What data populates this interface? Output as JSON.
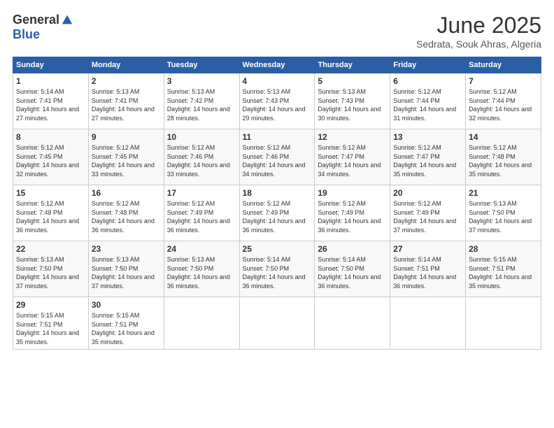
{
  "logo": {
    "general": "General",
    "blue": "Blue"
  },
  "title": "June 2025",
  "subtitle": "Sedrata, Souk Ahras, Algeria",
  "days_header": [
    "Sunday",
    "Monday",
    "Tuesday",
    "Wednesday",
    "Thursday",
    "Friday",
    "Saturday"
  ],
  "weeks": [
    [
      {
        "day": "1",
        "sunrise": "5:14 AM",
        "sunset": "7:41 PM",
        "daylight": "14 hours and 27 minutes."
      },
      {
        "day": "2",
        "sunrise": "5:13 AM",
        "sunset": "7:41 PM",
        "daylight": "14 hours and 27 minutes."
      },
      {
        "day": "3",
        "sunrise": "5:13 AM",
        "sunset": "7:42 PM",
        "daylight": "14 hours and 28 minutes."
      },
      {
        "day": "4",
        "sunrise": "5:13 AM",
        "sunset": "7:43 PM",
        "daylight": "14 hours and 29 minutes."
      },
      {
        "day": "5",
        "sunrise": "5:13 AM",
        "sunset": "7:43 PM",
        "daylight": "14 hours and 30 minutes."
      },
      {
        "day": "6",
        "sunrise": "5:12 AM",
        "sunset": "7:44 PM",
        "daylight": "14 hours and 31 minutes."
      },
      {
        "day": "7",
        "sunrise": "5:12 AM",
        "sunset": "7:44 PM",
        "daylight": "14 hours and 32 minutes."
      }
    ],
    [
      {
        "day": "8",
        "sunrise": "5:12 AM",
        "sunset": "7:45 PM",
        "daylight": "14 hours and 32 minutes."
      },
      {
        "day": "9",
        "sunrise": "5:12 AM",
        "sunset": "7:45 PM",
        "daylight": "14 hours and 33 minutes."
      },
      {
        "day": "10",
        "sunrise": "5:12 AM",
        "sunset": "7:46 PM",
        "daylight": "14 hours and 33 minutes."
      },
      {
        "day": "11",
        "sunrise": "5:12 AM",
        "sunset": "7:46 PM",
        "daylight": "14 hours and 34 minutes."
      },
      {
        "day": "12",
        "sunrise": "5:12 AM",
        "sunset": "7:47 PM",
        "daylight": "14 hours and 34 minutes."
      },
      {
        "day": "13",
        "sunrise": "5:12 AM",
        "sunset": "7:47 PM",
        "daylight": "14 hours and 35 minutes."
      },
      {
        "day": "14",
        "sunrise": "5:12 AM",
        "sunset": "7:48 PM",
        "daylight": "14 hours and 35 minutes."
      }
    ],
    [
      {
        "day": "15",
        "sunrise": "5:12 AM",
        "sunset": "7:48 PM",
        "daylight": "14 hours and 36 minutes."
      },
      {
        "day": "16",
        "sunrise": "5:12 AM",
        "sunset": "7:48 PM",
        "daylight": "14 hours and 36 minutes."
      },
      {
        "day": "17",
        "sunrise": "5:12 AM",
        "sunset": "7:49 PM",
        "daylight": "14 hours and 36 minutes."
      },
      {
        "day": "18",
        "sunrise": "5:12 AM",
        "sunset": "7:49 PM",
        "daylight": "14 hours and 36 minutes."
      },
      {
        "day": "19",
        "sunrise": "5:12 AM",
        "sunset": "7:49 PM",
        "daylight": "14 hours and 36 minutes."
      },
      {
        "day": "20",
        "sunrise": "5:12 AM",
        "sunset": "7:49 PM",
        "daylight": "14 hours and 37 minutes."
      },
      {
        "day": "21",
        "sunrise": "5:13 AM",
        "sunset": "7:50 PM",
        "daylight": "14 hours and 37 minutes."
      }
    ],
    [
      {
        "day": "22",
        "sunrise": "5:13 AM",
        "sunset": "7:50 PM",
        "daylight": "14 hours and 37 minutes."
      },
      {
        "day": "23",
        "sunrise": "5:13 AM",
        "sunset": "7:50 PM",
        "daylight": "14 hours and 37 minutes."
      },
      {
        "day": "24",
        "sunrise": "5:13 AM",
        "sunset": "7:50 PM",
        "daylight": "14 hours and 36 minutes."
      },
      {
        "day": "25",
        "sunrise": "5:14 AM",
        "sunset": "7:50 PM",
        "daylight": "14 hours and 36 minutes."
      },
      {
        "day": "26",
        "sunrise": "5:14 AM",
        "sunset": "7:50 PM",
        "daylight": "14 hours and 36 minutes."
      },
      {
        "day": "27",
        "sunrise": "5:14 AM",
        "sunset": "7:51 PM",
        "daylight": "14 hours and 36 minutes."
      },
      {
        "day": "28",
        "sunrise": "5:15 AM",
        "sunset": "7:51 PM",
        "daylight": "14 hours and 35 minutes."
      }
    ],
    [
      {
        "day": "29",
        "sunrise": "5:15 AM",
        "sunset": "7:51 PM",
        "daylight": "14 hours and 35 minutes."
      },
      {
        "day": "30",
        "sunrise": "5:15 AM",
        "sunset": "7:51 PM",
        "daylight": "14 hours and 35 minutes."
      },
      null,
      null,
      null,
      null,
      null
    ]
  ]
}
